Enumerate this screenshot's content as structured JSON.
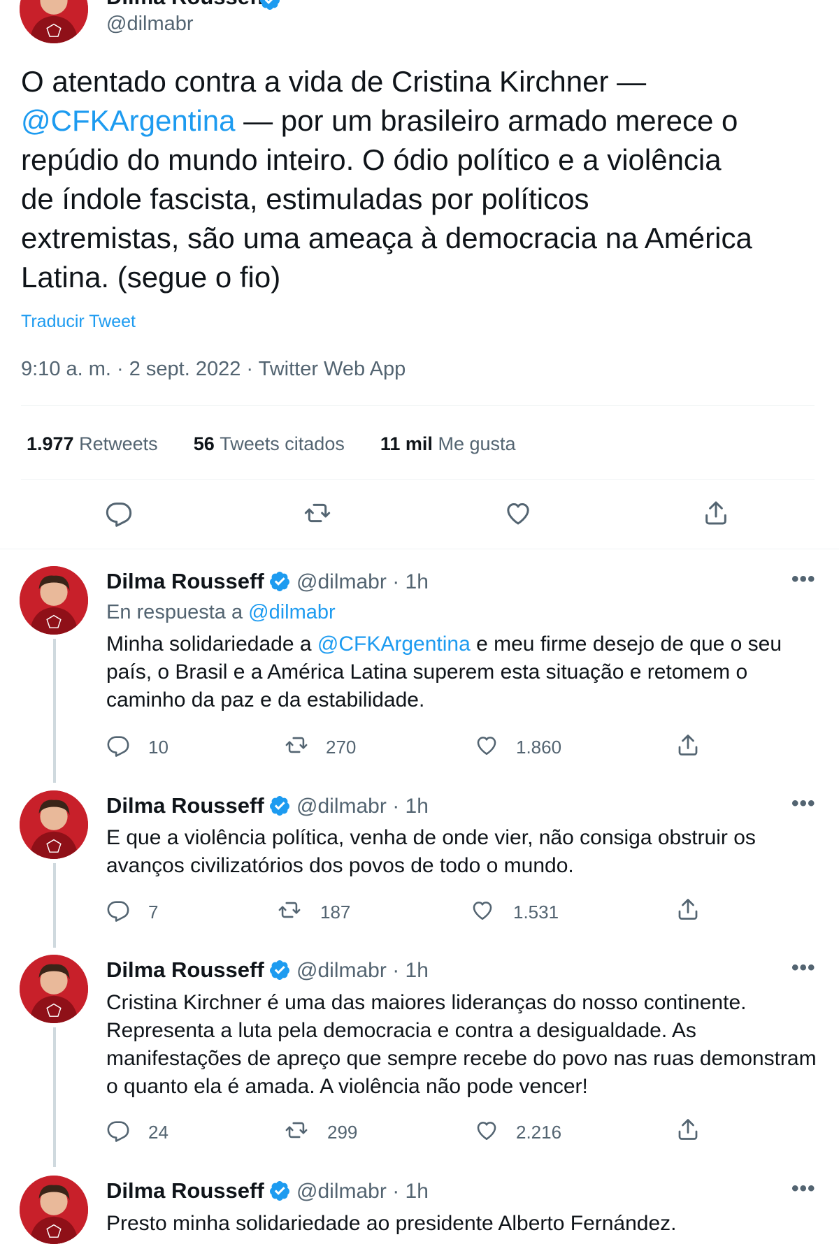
{
  "main_tweet": {
    "author_name": "Dilma Rousseff",
    "handle": "@dilmabr",
    "text_1": "O atentado contra a vida de Cristina Kirchner —",
    "mention": "@CFKArgentina",
    "text_2": " — por um brasileiro armado merece o",
    "text_3": "repúdio do mundo inteiro. O ódio político e a violência",
    "text_4": "de índole fascista, estimuladas por políticos",
    "text_5": "extremistas, são uma ameaça à democracia na América",
    "text_6": "Latina.  (segue o fio)",
    "translate": "Traducir Tweet",
    "timestamp": "9:10 a. m. · 2 sept. 2022 · Twitter Web App",
    "stats": {
      "retweets_count": "1.977",
      "retweets_label": "Retweets",
      "quotes_count": "56",
      "quotes_label": "Tweets citados",
      "likes_count": "11 mil",
      "likes_label": "Me gusta"
    }
  },
  "replies": [
    {
      "name": "Dilma Rousseff",
      "handle": "@dilmabr",
      "time": "· 1h",
      "reply_prefix": "En respuesta a",
      "reply_to": "@dilmabr",
      "line1_a": "Minha solidariedade a ",
      "line1_mention": "@CFKArgentina",
      "line1_b": " e meu firme desejo de que o seu",
      "line2": "país, o Brasil e a América Latina superem esta situação e retomem o",
      "line3": "caminho da paz e da estabilidade.",
      "replies": "10",
      "retweets": "270",
      "likes": "1.860"
    },
    {
      "name": "Dilma Rousseff",
      "handle": "@dilmabr",
      "time": "· 1h",
      "line1": "E que a violência política, venha de onde vier, não consiga obstruir os",
      "line2": "avanços civilizatórios dos povos de todo o mundo.",
      "replies": "7",
      "retweets": "187",
      "likes": "1.531"
    },
    {
      "name": "Dilma Rousseff",
      "handle": "@dilmabr",
      "time": "· 1h",
      "line1": "Cristina Kirchner é uma das maiores lideranças do nosso continente.",
      "line2": "Representa a luta pela democracia e contra a desigualdade. As",
      "line3": "manifestações de apreço que sempre recebe do povo nas ruas demonstram",
      "line4": "o quanto ela é amada. A violência não pode vencer!",
      "replies": "24",
      "retweets": "299",
      "likes": "2.216"
    },
    {
      "name": "Dilma Rousseff",
      "handle": "@dilmabr",
      "time": "· 1h",
      "line1": "Presto minha solidariedade ao presidente Alberto Fernández."
    }
  ],
  "colors": {
    "accent": "#1d9bf0",
    "muted": "#536471",
    "avatar_bg": "#c8202a"
  },
  "icons": [
    "reply-icon",
    "retweet-icon",
    "like-icon",
    "share-icon",
    "verified-icon",
    "more-icon"
  ]
}
